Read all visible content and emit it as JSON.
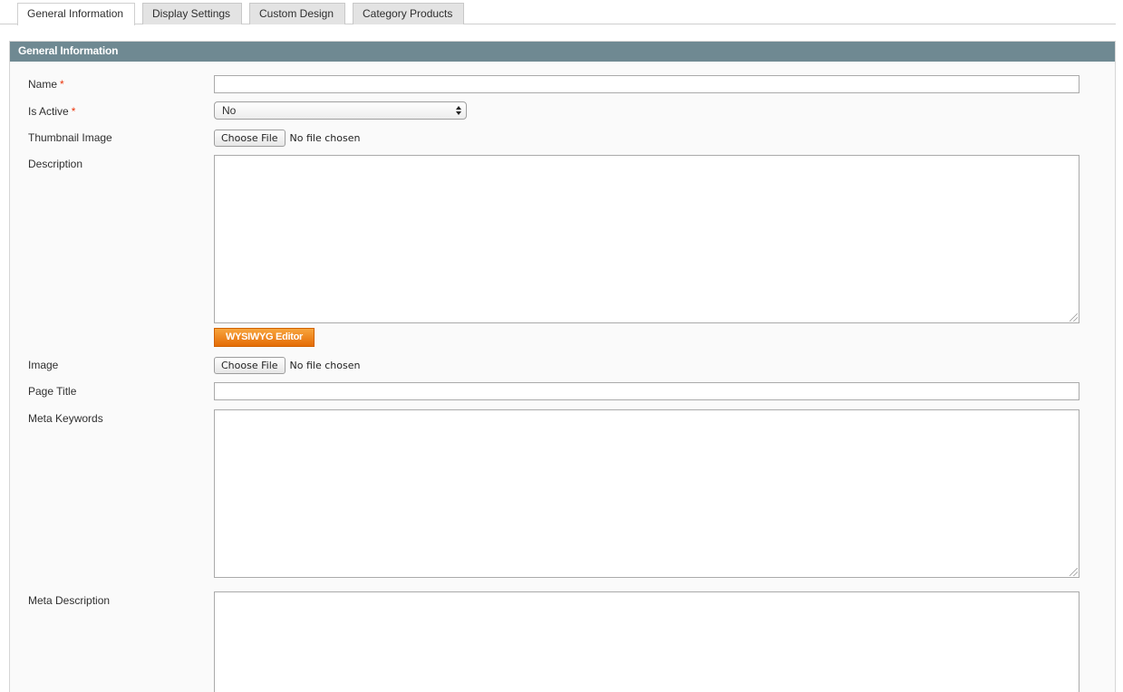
{
  "tabs": [
    {
      "label": "General Information",
      "active": true
    },
    {
      "label": "Display Settings",
      "active": false
    },
    {
      "label": "Custom Design",
      "active": false
    },
    {
      "label": "Category Products",
      "active": false
    }
  ],
  "section": {
    "title": "General Information"
  },
  "fields": {
    "name": {
      "label": "Name",
      "required": "*",
      "value": ""
    },
    "is_active": {
      "label": "Is Active",
      "required": "*",
      "selected": "No"
    },
    "thumbnail": {
      "label": "Thumbnail Image",
      "button": "Choose File",
      "status": "No file chosen"
    },
    "description": {
      "label": "Description",
      "value": "",
      "editor_button": "WYSIWYG Editor"
    },
    "image": {
      "label": "Image",
      "button": "Choose File",
      "status": "No file chosen"
    },
    "page_title": {
      "label": "Page Title",
      "value": ""
    },
    "meta_keywords": {
      "label": "Meta Keywords",
      "value": ""
    },
    "meta_description": {
      "label": "Meta Description",
      "value": ""
    }
  },
  "colors": {
    "section_header": "#6f8992",
    "required_marker": "#eb340a",
    "editor_button": "#f08a1f"
  },
  "icons": {
    "select_arrows": "up-down-arrows-icon",
    "resize_grip": "resize-grip-icon"
  }
}
